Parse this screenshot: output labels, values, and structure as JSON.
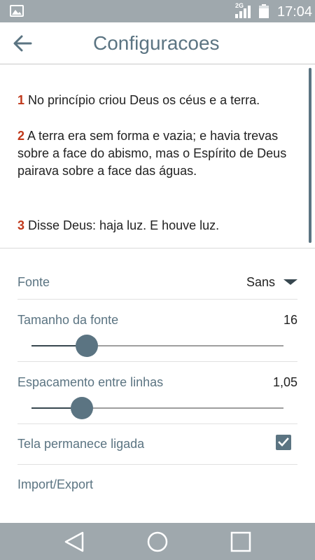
{
  "status_bar": {
    "network": "2G",
    "time": "17:04",
    "icons": [
      "image-icon",
      "signal-icon",
      "battery-icon"
    ]
  },
  "app_bar": {
    "title": "Configuracoes",
    "back_icon": "arrow-left-icon"
  },
  "preview": {
    "verses": [
      {
        "number": "1",
        "text": " No princípio criou Deus os céus e a terra."
      },
      {
        "number": "2",
        "text": " A terra era sem forma e vazia; e havia trevas sobre a face do abismo, mas o Espírito de Deus pairava sobre a face das águas."
      },
      {
        "number": "3",
        "text": " Disse Deus: haja luz. E houve luz."
      }
    ]
  },
  "settings": {
    "font": {
      "label": "Fonte",
      "value": "Sans"
    },
    "font_size": {
      "label": "Tamanho da fonte",
      "value": "16",
      "slider_fraction": 0.22
    },
    "line_spacing": {
      "label": "Espacamento entre linhas",
      "value": "1,05",
      "slider_fraction": 0.2
    },
    "screen_on": {
      "label": "Tela permanece ligada",
      "checked": true
    },
    "import_export": {
      "label": "Import/Export"
    }
  },
  "nav_bar": {
    "icons": [
      "back-triangle-icon",
      "home-circle-icon",
      "recents-square-icon"
    ]
  },
  "colors": {
    "accent": "#5b7482",
    "verse_number": "#c0391b",
    "system_bars": "#9fa8ad"
  }
}
